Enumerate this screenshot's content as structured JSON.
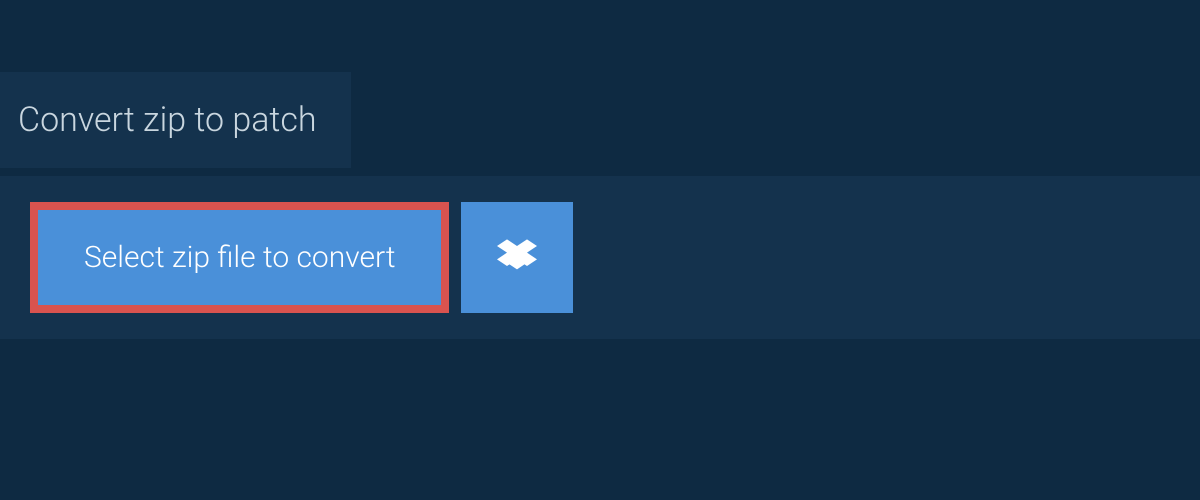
{
  "header": {
    "title": "Convert zip to patch"
  },
  "actions": {
    "select_file_label": "Select zip file to convert",
    "dropbox_icon": "dropbox-icon"
  },
  "colors": {
    "page_bg": "#0e2a42",
    "panel_bg": "#14324d",
    "button_bg": "#4a90d9",
    "highlight_border": "#d9534f",
    "text_light": "#ffffff",
    "title_text": "#c9d6df"
  }
}
